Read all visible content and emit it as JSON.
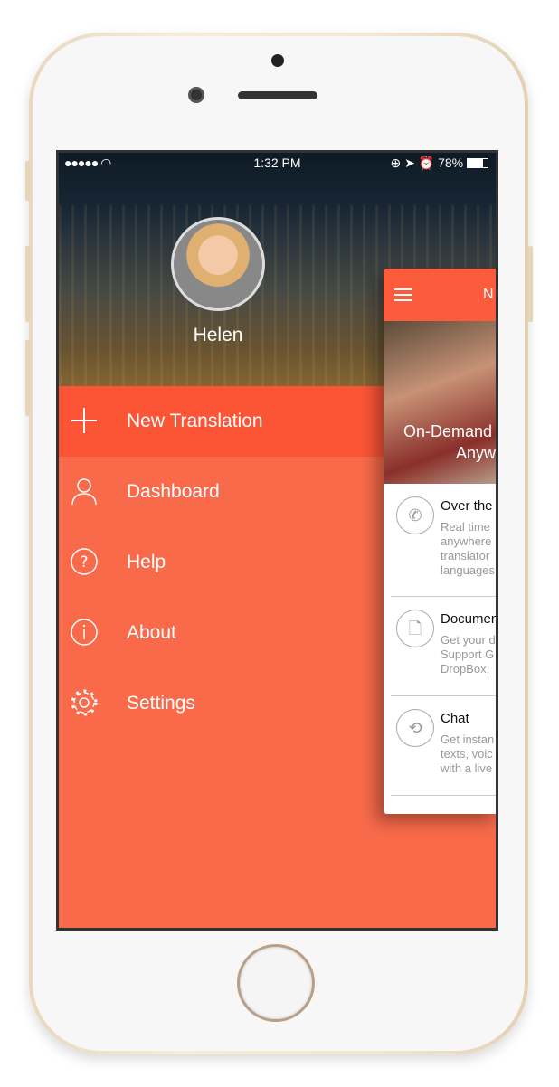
{
  "status_bar": {
    "signal": "●●●●●",
    "wifi": "wifi-icon",
    "time": "1:32 PM",
    "battery": "78%"
  },
  "profile": {
    "name": "Helen"
  },
  "menu": {
    "items": [
      {
        "label": "New Translation",
        "icon": "plus-icon"
      },
      {
        "label": "Dashboard",
        "icon": "user-icon"
      },
      {
        "label": "Help",
        "icon": "question-icon"
      },
      {
        "label": "About",
        "icon": "info-icon"
      },
      {
        "label": "Settings",
        "icon": "gear-icon"
      }
    ]
  },
  "card": {
    "title": "N",
    "banner_line1": "On-Demand",
    "banner_line2": "Anyw",
    "features": [
      {
        "title": "Over the",
        "desc": [
          "Real time",
          "anywhere",
          "translator",
          "languages"
        ]
      },
      {
        "title": "Documen",
        "desc": [
          "Get your d",
          "Support G",
          "DropBox,"
        ]
      },
      {
        "title": "Chat",
        "desc": [
          "Get instan",
          "texts, voic",
          "with a live"
        ]
      }
    ]
  },
  "colors": {
    "menu_bg": "#f96a4b",
    "active_bg": "#fb5536",
    "card_header": "#fc5b3c"
  }
}
